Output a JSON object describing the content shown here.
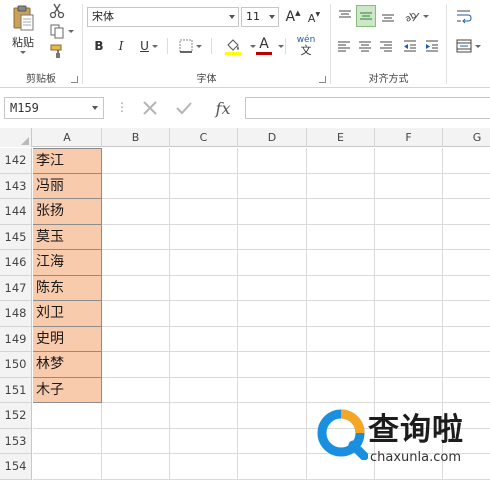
{
  "ribbon": {
    "clipboard": {
      "paste_label": "粘贴",
      "group_label": "剪贴板"
    },
    "font": {
      "font_name": "宋体",
      "font_size": "11",
      "bold": "B",
      "italic": "I",
      "underline": "U",
      "grow": "A",
      "shrink": "A",
      "font_color_letter": "A",
      "phonetic": "wén",
      "group_label": "字体"
    },
    "alignment": {
      "group_label": "对齐方式"
    }
  },
  "formula_bar": {
    "name_box": "M159",
    "fx": "fx",
    "formula": ""
  },
  "columns": [
    "A",
    "B",
    "C",
    "D",
    "E",
    "F",
    "G"
  ],
  "rows": [
    {
      "num": "142",
      "a": "李江"
    },
    {
      "num": "143",
      "a": "冯丽"
    },
    {
      "num": "144",
      "a": "张扬"
    },
    {
      "num": "145",
      "a": "莫玉"
    },
    {
      "num": "146",
      "a": "江海"
    },
    {
      "num": "147",
      "a": "陈东"
    },
    {
      "num": "148",
      "a": "刘卫"
    },
    {
      "num": "149",
      "a": "史明"
    },
    {
      "num": "150",
      "a": "林梦"
    },
    {
      "num": "151",
      "a": "木子"
    },
    {
      "num": "152",
      "a": ""
    },
    {
      "num": "153",
      "a": ""
    },
    {
      "num": "154",
      "a": ""
    }
  ],
  "colors": {
    "filled_cell": "#f8cbad",
    "selected_align": "#cde6c7",
    "font_color_bar": "#c00000",
    "highlight_bar": "#ffff00",
    "watermark_blue": "#1a8fe0",
    "watermark_orange": "#f5a623"
  },
  "watermark": {
    "title": "查询啦",
    "url": "chaxunla.com"
  }
}
